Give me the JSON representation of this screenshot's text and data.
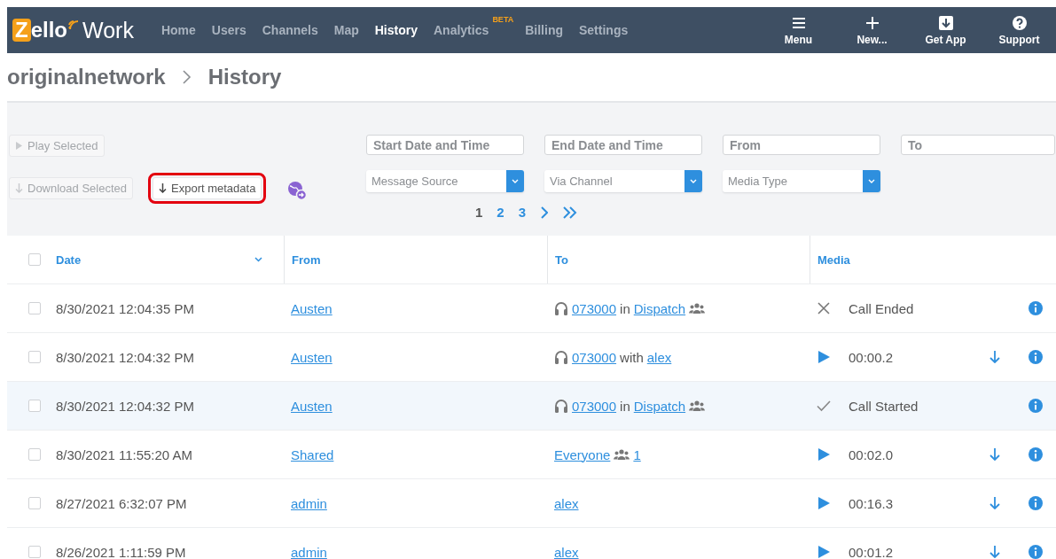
{
  "logo": {
    "brand": "Zello",
    "product": "Work"
  },
  "nav": [
    {
      "label": "Home",
      "selected": false
    },
    {
      "label": "Users",
      "selected": false
    },
    {
      "label": "Channels",
      "selected": false
    },
    {
      "label": "Map",
      "selected": false
    },
    {
      "label": "History",
      "selected": true
    },
    {
      "label": "Analytics",
      "selected": false,
      "badge": "BETA"
    },
    {
      "label": "Billing",
      "selected": false
    },
    {
      "label": "Settings",
      "selected": false
    }
  ],
  "nav_actions": [
    {
      "kind": "menu",
      "label": "Menu"
    },
    {
      "kind": "new",
      "label": "New..."
    },
    {
      "kind": "getapp",
      "label": "Get App"
    },
    {
      "kind": "support",
      "label": "Support"
    }
  ],
  "breadcrumb": [
    "originalnetwork",
    "History"
  ],
  "actions": [
    {
      "kind": "play",
      "label": "Play Selected",
      "disabled": true,
      "highlighted": false
    },
    {
      "kind": "download",
      "label": "Download Selected",
      "disabled": true,
      "highlighted": false
    },
    {
      "kind": "download",
      "label": "Export metadata",
      "disabled": false,
      "highlighted": true
    }
  ],
  "filters": [
    {
      "kind": "input",
      "placeholder": "Start Date and Time"
    },
    {
      "kind": "input",
      "placeholder": "End Date and Time"
    },
    {
      "kind": "input",
      "placeholder": "From"
    },
    {
      "kind": "input",
      "placeholder": "To"
    },
    {
      "kind": "select",
      "placeholder": "Message Source"
    },
    {
      "kind": "select",
      "placeholder": "Via Channel"
    },
    {
      "kind": "select",
      "placeholder": "Media Type"
    }
  ],
  "pagination": [
    {
      "kind": "page",
      "label": "1",
      "selected": true
    },
    {
      "kind": "page",
      "label": "2",
      "selected": false
    },
    {
      "kind": "page",
      "label": "3",
      "selected": false
    },
    {
      "kind": "next"
    },
    {
      "kind": "last"
    }
  ],
  "table": {
    "select_all": {
      "checked": false
    },
    "columns": [
      {
        "label": "Date",
        "sorted": true
      },
      {
        "label": "From",
        "sorted": false
      },
      {
        "label": "To",
        "sorted": false
      },
      {
        "label": "Media",
        "sorted": false
      }
    ],
    "rows": [
      {
        "checked": false,
        "highlighted": false,
        "date": "8/30/2021 12:04:35 PM",
        "from": "Austen",
        "to": [
          {
            "kind": "headset"
          },
          {
            "kind": "link",
            "text": "073000"
          },
          {
            "kind": "text",
            "text": "in"
          },
          {
            "kind": "link",
            "text": "Dispatch"
          },
          {
            "kind": "group"
          }
        ],
        "media": {
          "kind": "ended",
          "text": "Call Ended"
        },
        "download": false
      },
      {
        "checked": false,
        "highlighted": false,
        "date": "8/30/2021 12:04:32 PM",
        "from": "Austen",
        "to": [
          {
            "kind": "headset"
          },
          {
            "kind": "link",
            "text": "073000"
          },
          {
            "kind": "text",
            "text": "with"
          },
          {
            "kind": "link",
            "text": "alex"
          }
        ],
        "media": {
          "kind": "play",
          "text": "00:00.2"
        },
        "download": true
      },
      {
        "checked": false,
        "highlighted": true,
        "date": "8/30/2021 12:04:32 PM",
        "from": "Austen",
        "to": [
          {
            "kind": "headset"
          },
          {
            "kind": "link",
            "text": "073000"
          },
          {
            "kind": "text",
            "text": "in"
          },
          {
            "kind": "link",
            "text": "Dispatch"
          },
          {
            "kind": "group"
          }
        ],
        "media": {
          "kind": "started",
          "text": "Call Started"
        },
        "download": false
      },
      {
        "checked": false,
        "highlighted": false,
        "date": "8/30/2021 11:55:20 AM",
        "from": "Shared",
        "to": [
          {
            "kind": "link",
            "text": "Everyone"
          },
          {
            "kind": "group"
          },
          {
            "kind": "link",
            "text": "1"
          }
        ],
        "media": {
          "kind": "play",
          "text": "00:02.0"
        },
        "download": true
      },
      {
        "checked": false,
        "highlighted": false,
        "date": "8/27/2021 6:32:07 PM",
        "from": "admin",
        "to": [
          {
            "kind": "link",
            "text": "alex"
          }
        ],
        "media": {
          "kind": "play",
          "text": "00:16.3"
        },
        "download": true
      },
      {
        "checked": false,
        "highlighted": false,
        "date": "8/26/2021 1:11:59 PM",
        "from": "admin",
        "to": [
          {
            "kind": "link",
            "text": "alex"
          }
        ],
        "media": {
          "kind": "play",
          "text": "00:01.2"
        },
        "download": true
      }
    ]
  }
}
